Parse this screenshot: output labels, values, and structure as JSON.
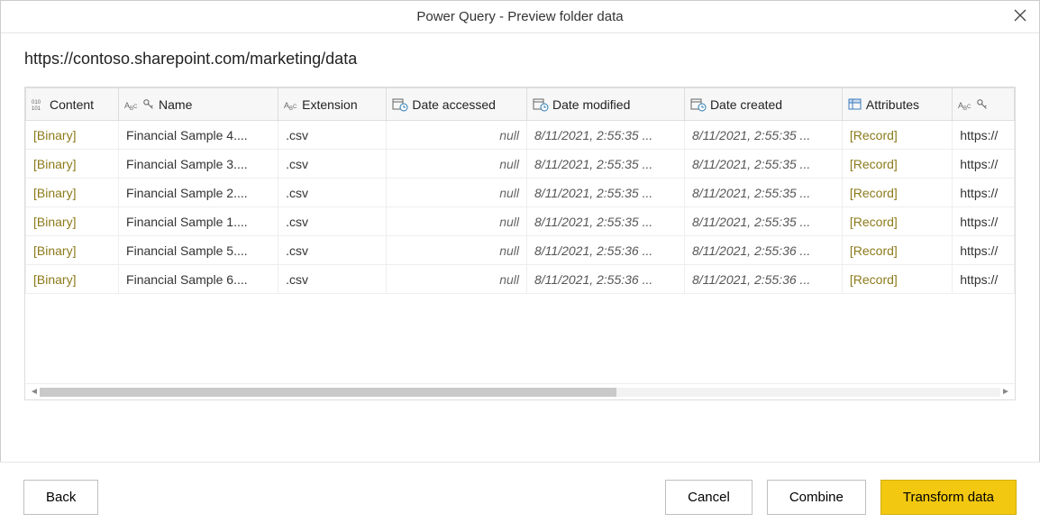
{
  "title": "Power Query - Preview folder data",
  "url": "https://contoso.sharepoint.com/marketing/data",
  "columns": {
    "content": "Content",
    "name": "Name",
    "extension": "Extension",
    "date_accessed": "Date accessed",
    "date_modified": "Date modified",
    "date_created": "Date created",
    "attributes": "Attributes",
    "folder_path": ""
  },
  "rows": [
    {
      "content": "[Binary]",
      "name": "Financial Sample 4....",
      "ext": ".csv",
      "acc": "null",
      "mod": "8/11/2021, 2:55:35 ...",
      "crt": "8/11/2021, 2:55:35 ...",
      "attr": "[Record]",
      "path": "https://"
    },
    {
      "content": "[Binary]",
      "name": "Financial Sample 3....",
      "ext": ".csv",
      "acc": "null",
      "mod": "8/11/2021, 2:55:35 ...",
      "crt": "8/11/2021, 2:55:35 ...",
      "attr": "[Record]",
      "path": "https://"
    },
    {
      "content": "[Binary]",
      "name": "Financial Sample 2....",
      "ext": ".csv",
      "acc": "null",
      "mod": "8/11/2021, 2:55:35 ...",
      "crt": "8/11/2021, 2:55:35 ...",
      "attr": "[Record]",
      "path": "https://"
    },
    {
      "content": "[Binary]",
      "name": "Financial Sample 1....",
      "ext": ".csv",
      "acc": "null",
      "mod": "8/11/2021, 2:55:35 ...",
      "crt": "8/11/2021, 2:55:35 ...",
      "attr": "[Record]",
      "path": "https://"
    },
    {
      "content": "[Binary]",
      "name": "Financial Sample 5....",
      "ext": ".csv",
      "acc": "null",
      "mod": "8/11/2021, 2:55:36 ...",
      "crt": "8/11/2021, 2:55:36 ...",
      "attr": "[Record]",
      "path": "https://"
    },
    {
      "content": "[Binary]",
      "name": "Financial Sample 6....",
      "ext": ".csv",
      "acc": "null",
      "mod": "8/11/2021, 2:55:36 ...",
      "crt": "8/11/2021, 2:55:36 ...",
      "attr": "[Record]",
      "path": "https://"
    }
  ],
  "buttons": {
    "back": "Back",
    "cancel": "Cancel",
    "combine": "Combine",
    "transform": "Transform data"
  }
}
